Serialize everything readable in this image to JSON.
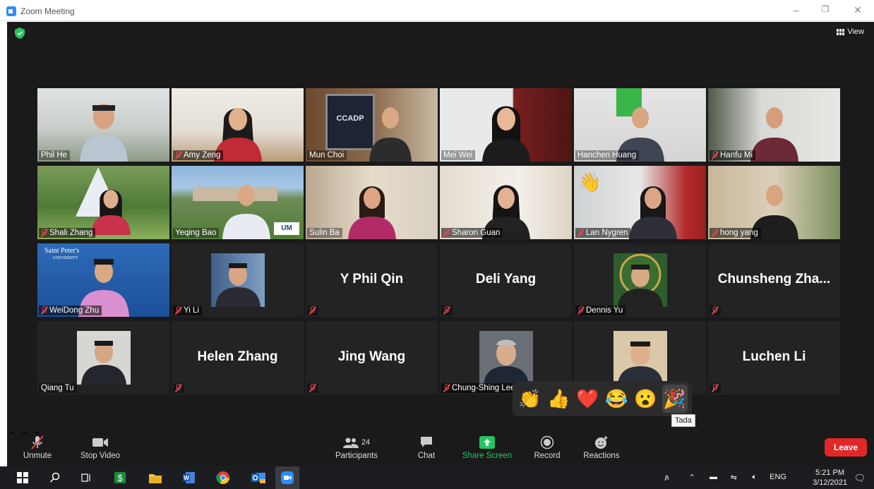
{
  "window": {
    "title": "Zoom Meeting"
  },
  "header": {
    "view_label": "View"
  },
  "tiles": [
    {
      "label": "Phil He",
      "muted": false,
      "active": true
    },
    {
      "label": "Amy Zeng",
      "muted": true
    },
    {
      "label": "Mun Choi",
      "muted": false
    },
    {
      "label": "Mei Wei",
      "muted": false
    },
    {
      "label": "Hanchen Huang",
      "muted": false
    },
    {
      "label": "Hanfu Mi",
      "muted": true
    },
    {
      "label": "Shali Zhang",
      "muted": true
    },
    {
      "label": "Yeqing Bao",
      "muted": false
    },
    {
      "label": "Sulin Ba",
      "muted": false
    },
    {
      "label": "Sharon Guan",
      "muted": true
    },
    {
      "label": "Lan Nygren",
      "muted": true
    },
    {
      "label": "hong yang",
      "muted": true
    },
    {
      "label": "WeiDong Zhu",
      "muted": true
    },
    {
      "label": "Yi Li",
      "muted": true
    },
    {
      "label": "",
      "muted": true,
      "big_name": "Y Phil Qin"
    },
    {
      "label": "",
      "muted": true,
      "big_name": "Deli Yang"
    },
    {
      "label": "Dennis Yu",
      "muted": true
    },
    {
      "label": "",
      "muted": true,
      "big_name": "Chunsheng  Zha..."
    },
    {
      "label": "Qiang Tu",
      "muted": false
    },
    {
      "label": "",
      "muted": true,
      "big_name": "Helen Zhang"
    },
    {
      "label": "",
      "muted": true,
      "big_name": "Jing Wang"
    },
    {
      "label": "Chung-Shing Lee",
      "muted": true
    },
    {
      "label": "",
      "muted": false
    },
    {
      "label": "",
      "muted": true,
      "big_name": "Luchen Li"
    }
  ],
  "tile_logos": {
    "ccadp": "CCADP",
    "saint_peters": "Saint Peter's",
    "saint_peters_sub": "UNIVERSITY",
    "um": "UM"
  },
  "reactions": {
    "emojis": [
      "👏",
      "👍",
      "❤️",
      "😂",
      "😮",
      "🎉"
    ],
    "hovered_tooltip": "Tada"
  },
  "toolbar": {
    "unmute_label": "Unmute",
    "stop_video_label": "Stop Video",
    "participants_label": "Participants",
    "participants_count": "24",
    "chat_label": "Chat",
    "share_screen_label": "Share Screen",
    "record_label": "Record",
    "reactions_label": "Reactions",
    "leave_label": "Leave"
  },
  "taskbar": {
    "language": "ENG",
    "time": "5:21 PM",
    "date": "3/12/2021"
  },
  "colors": {
    "active_speaker_border": "#c3e87a",
    "share_green": "#23c55e",
    "leave_red": "#e02828",
    "muted_red": "#e0484e"
  }
}
